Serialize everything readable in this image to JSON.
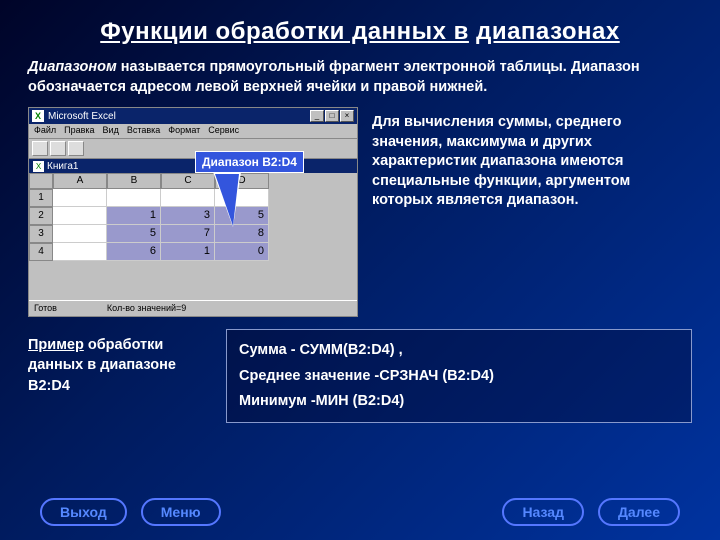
{
  "title_part1": "Функции обработки данных в",
  "title_part2": "диапазонах",
  "intro_em": "Диапазоном",
  "intro_rest": " называется прямоугольный фрагмент электронной таблицы. Диапазон обозначается адресом левой верхней ячейки и правой нижней.",
  "excel": {
    "app": "Microsoft Excel",
    "menu": [
      "Файл",
      "Правка",
      "Вид",
      "Вставка",
      "Формат",
      "Сервис"
    ],
    "book": "Книга1",
    "cols": [
      "A",
      "B",
      "C",
      "D"
    ],
    "rows": [
      "1",
      "2",
      "3",
      "4"
    ],
    "data": {
      "r2": [
        "1",
        "3",
        "5"
      ],
      "r3": [
        "5",
        "7",
        "8"
      ],
      "r4": [
        "6",
        "1",
        "0"
      ]
    },
    "status_left": "Готов",
    "status_right": "Кол-во значений=9"
  },
  "callout": "Диапазон B2:D4",
  "right_text": "Для вычисления суммы, среднего значения, максимума и других характеристик  диапазона имеются специальные функции, аргументом которых является  диапазон.",
  "example_u": "Пример",
  "example_rest": " обработки данных в диапазоне B2:D4",
  "formulas": {
    "l1": "Сумма  -   СУММ(B2:D4) ,",
    "l2": "Среднее значение -СРЗНАЧ (B2:D4)",
    "l3": "Минимум -МИН (B2:D4)"
  },
  "nav": {
    "exit": "Выход",
    "menu": "Меню",
    "back": "Назад",
    "next": "Далее"
  }
}
